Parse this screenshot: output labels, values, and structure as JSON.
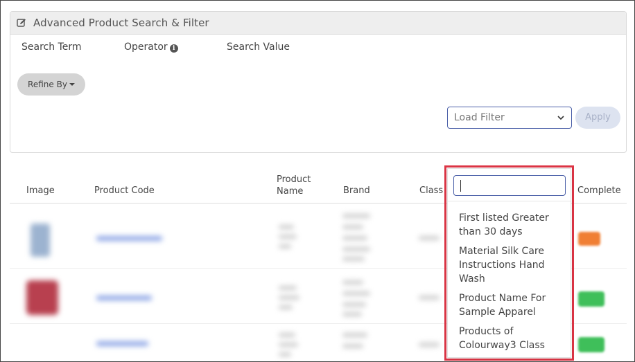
{
  "panel": {
    "title": "Advanced Product Search & Filter",
    "columns": {
      "search_term": "Search Term",
      "operator": "Operator",
      "search_value": "Search Value"
    },
    "refine_by_label": "Refine By",
    "load_filter_placeholder": "Load Filter",
    "apply_label": "Apply"
  },
  "table": {
    "headers": {
      "image": "Image",
      "product_code": "Product Code",
      "product_name": "Product Name",
      "brand": "Brand",
      "class": "Class",
      "complete": "Complete"
    }
  },
  "dropdown": {
    "search_value": "",
    "options": [
      "First listed Greater than 30 days",
      "Material Silk Care Instructions Hand Wash",
      "Product Name For Sample Apparel",
      "Products of Colourway3 Class"
    ]
  },
  "icons": {
    "edit": "edit-icon",
    "info": "info-icon",
    "caret": "caret-down-icon",
    "chevron": "chevron-down-icon"
  },
  "colors": {
    "highlight": "#dc3545",
    "accent_border": "#4a5fa8",
    "badge_orange": "#f07f34",
    "badge_green": "#3fbf5a"
  }
}
